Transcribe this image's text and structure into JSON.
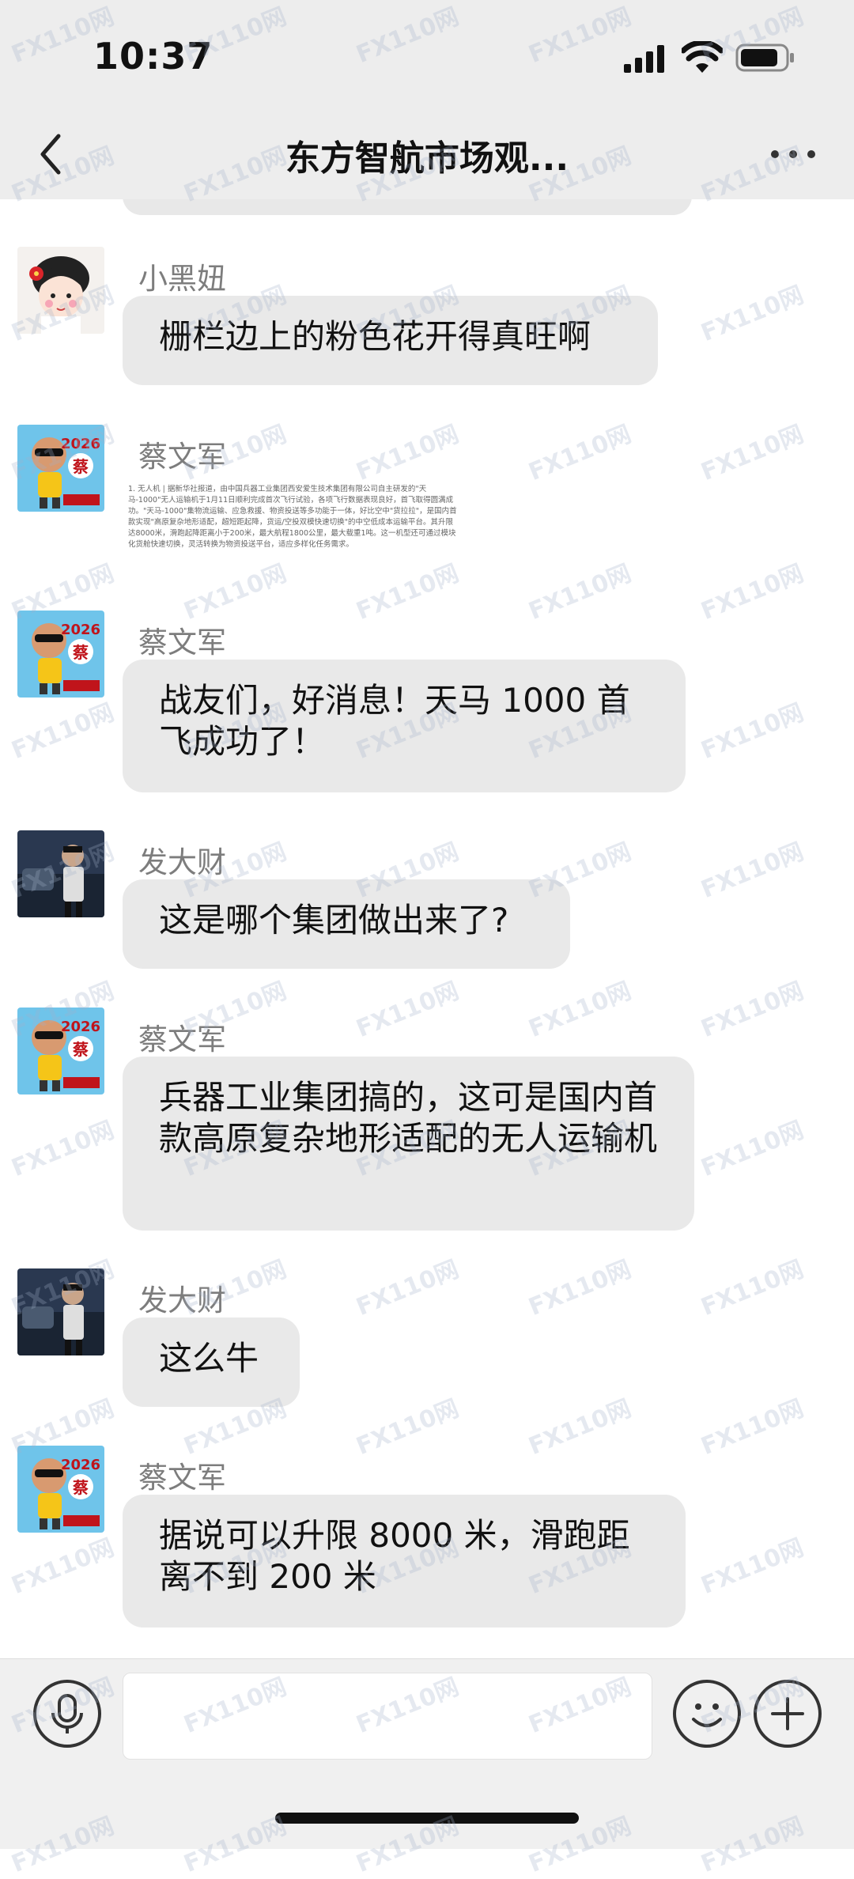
{
  "status_bar": {
    "time": "10:37"
  },
  "nav": {
    "title": "东方智航市场观..."
  },
  "messages": [
    {
      "sender": "小黑妞",
      "type": "text",
      "text": "栅栏边上的粉色花开得真旺啊"
    },
    {
      "sender": "蔡文军",
      "type": "image",
      "image_text": "1. 无人机 | 据新华社报道，由中国兵器工业集团西安爱生技术集团有限公司自主研发的\"天马-1000\"无人运输机于1月11日顺利完成首次飞行试验，各项飞行数据表现良好，首飞取得圆满成功。\"天马-1000\"集物流运输、应急救援、物资投送等多功能于一体，好比空中\"货拉拉\"，是国内首款实现\"高原复杂地形适配，超短距起降，货运/空投双模快速切换\"的中空低成本运输平台。其升限达8000米，滑跑起降距离小于200米，最大航程1800公里，最大载重1吨。这一机型还可通过模块化货舱快速切换，灵活转换为物资投送平台，适应多样化任务需求。"
    },
    {
      "sender": "蔡文军",
      "type": "text",
      "text": "战友们，好消息！天马 1000 首飞成功了！"
    },
    {
      "sender": "发大财",
      "type": "text",
      "text": "这是哪个集团做出来了?"
    },
    {
      "sender": "蔡文军",
      "type": "text",
      "text": "兵器工业集团搞的，这可是国内首款高原复杂地形适配的无人运输机"
    },
    {
      "sender": "发大财",
      "type": "text",
      "text": "这么牛"
    },
    {
      "sender": "蔡文军",
      "type": "text",
      "text": "据说可以升限 8000 米，滑跑距离不到 200 米"
    }
  ],
  "avatar_labels": {
    "cai_year": "2026",
    "cai_char": "蔡"
  },
  "watermark": {
    "text": "FX110网"
  },
  "colors": {
    "bar_bg": "#ededed",
    "bubble_bg": "#e9e9e9",
    "sender_gray": "#7d7d7d"
  }
}
